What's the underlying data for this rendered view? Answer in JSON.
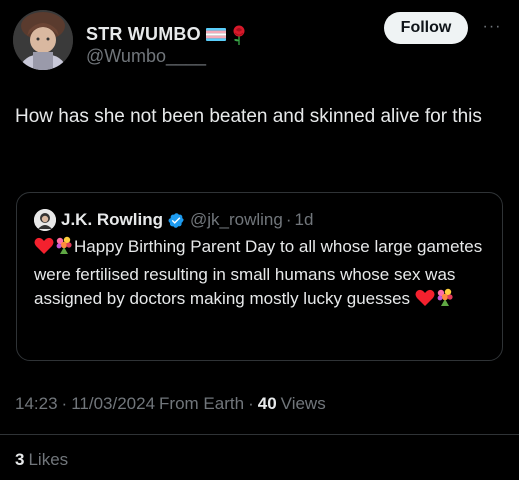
{
  "author": {
    "display_name": "STR WUMBO",
    "handle": "@Wumbo____",
    "name_icons": [
      "transgender-flag-icon",
      "rose-icon"
    ]
  },
  "actions": {
    "follow_label": "Follow",
    "more_label": "···"
  },
  "tweet": {
    "text": "How has she not been beaten and skinned alive for this"
  },
  "quote": {
    "name": "J.K. Rowling",
    "handle": "@jk_rowling",
    "separator": "·",
    "time": "1d",
    "text_line": "Happy Birthing Parent Day to all whose large gametes were fertilised resulting in small humans whose sex was assigned by doctors making mostly lucky guesses",
    "leading_icons": [
      "red-heart-icon",
      "bouquet-icon"
    ],
    "trailing_icons": [
      "red-heart-icon",
      "bouquet-icon"
    ]
  },
  "meta": {
    "time": "14:23",
    "sep1": "·",
    "date": "11/03/2024",
    "source": "From Earth",
    "sep2": "·",
    "views_count": "40",
    "views_label": "Views"
  },
  "engagement": {
    "likes_count": "3",
    "likes_label": "Likes"
  },
  "colors": {
    "background": "#000000",
    "text": "#e7e9ea",
    "muted": "#71767b",
    "border": "#2f3336",
    "verified": "#1d9bf0",
    "heart": "#f4212e"
  }
}
